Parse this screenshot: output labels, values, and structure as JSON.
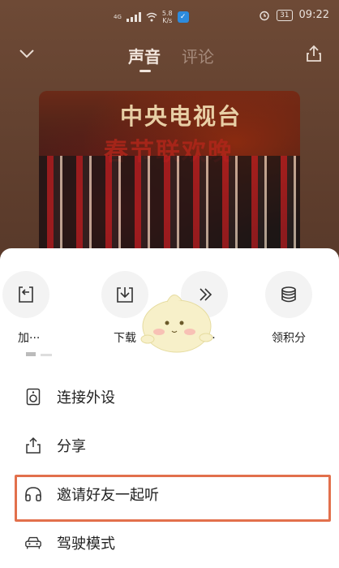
{
  "status_bar": {
    "network_type": "4G",
    "net_speed_value": "5.8",
    "net_speed_unit": "K/s",
    "battery": "31",
    "time": "09:22"
  },
  "header": {
    "tab_sound": "声音",
    "tab_comment": "评论"
  },
  "cover": {
    "title_text": "中央电视台",
    "subtitle_text": "春节联欢晚"
  },
  "actions": [
    {
      "label": "加···",
      "icon": "add-to-list-icon"
    },
    {
      "label": "下载",
      "icon": "download-icon"
    },
    {
      "label": "跳···",
      "icon": "skip-icon"
    },
    {
      "label": "领积分",
      "icon": "points-coins-icon"
    }
  ],
  "menu": [
    {
      "label": "连接外设",
      "icon": "speaker-device-icon"
    },
    {
      "label": "分享",
      "icon": "share-icon"
    },
    {
      "label": "邀请好友一起听",
      "icon": "headphones-icon",
      "highlighted": true
    },
    {
      "label": "驾驶模式",
      "icon": "car-icon"
    }
  ],
  "colors": {
    "highlight_border": "#e2704c",
    "sheet_background": "#ffffff",
    "player_background": "#5b3b2b"
  }
}
